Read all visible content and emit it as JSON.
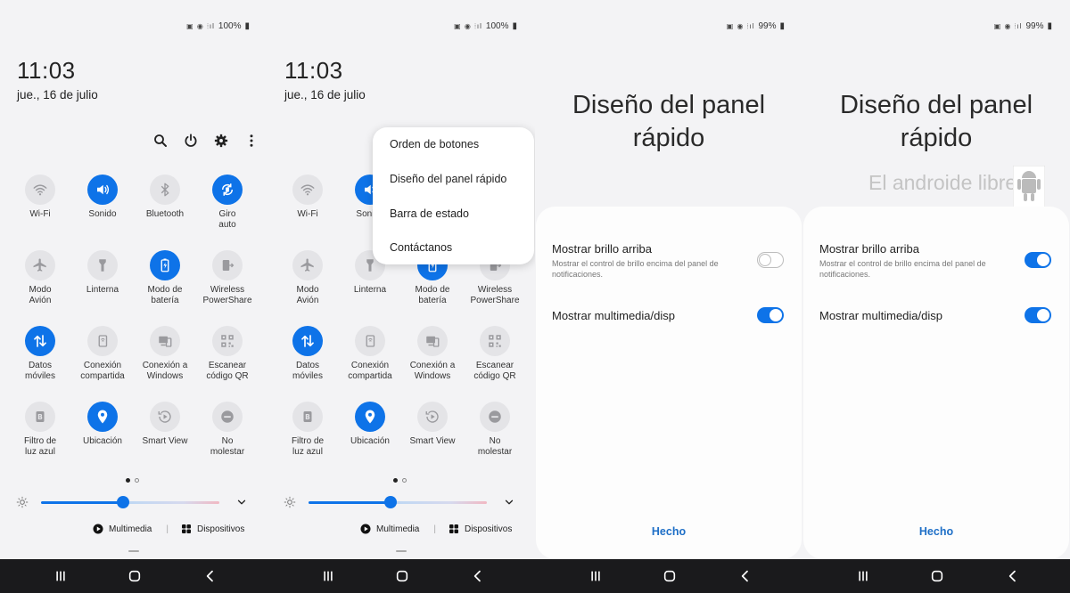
{
  "colors": {
    "accent": "#0e73e8",
    "tile_off": "#e4e4e7",
    "panel_bg": "#f3f3f5",
    "navbar": "#1a1a1c",
    "done_text": "#1e6fc7"
  },
  "status": {
    "icons": "▣ ◉ ⦙ıl",
    "battery_full": "100%",
    "battery_low": "99%"
  },
  "notification_panel": {
    "time": "11:03",
    "date": "jue., 16 de julio",
    "actions": [
      {
        "name": "search",
        "icon": "search-icon"
      },
      {
        "name": "power",
        "icon": "power-icon"
      },
      {
        "name": "settings",
        "icon": "gear-icon"
      },
      {
        "name": "more",
        "icon": "more-vert-icon"
      }
    ],
    "tiles": [
      {
        "label": "Wi-Fi",
        "icon": "wifi-icon",
        "on": false
      },
      {
        "label": "Sonido",
        "icon": "sound-icon",
        "on": true
      },
      {
        "label": "Bluetooth",
        "icon": "bluetooth-icon",
        "on": false
      },
      {
        "label": "Giro\nauto",
        "icon": "rotate-icon",
        "on": true
      },
      {
        "label": "Modo\nAvión",
        "icon": "airplane-icon",
        "on": false
      },
      {
        "label": "Linterna",
        "icon": "flashlight-icon",
        "on": false
      },
      {
        "label": "Modo de\nbatería",
        "icon": "battery-mode-icon",
        "on": true
      },
      {
        "label": "Wireless\nPowerShare",
        "icon": "powershare-icon",
        "on": false
      },
      {
        "label": "Datos\nmóviles",
        "icon": "mobile-data-icon",
        "on": true
      },
      {
        "label": "Conexión\ncompartida",
        "icon": "hotspot-icon",
        "on": false
      },
      {
        "label": "Conexión a\nWindows",
        "icon": "link-windows-icon",
        "on": false
      },
      {
        "label": "Escanear\ncódigo QR",
        "icon": "qr-icon",
        "on": false
      },
      {
        "label": "Filtro de\nluz azul",
        "icon": "blue-light-icon",
        "on": false
      },
      {
        "label": "Ubicación",
        "icon": "location-icon",
        "on": true
      },
      {
        "label": "Smart View",
        "icon": "smart-view-icon",
        "on": false
      },
      {
        "label": "No\nmolestar",
        "icon": "dnd-icon",
        "on": false
      }
    ],
    "page_indicator": {
      "current": 1,
      "total": 2
    },
    "brightness_level": 0.46,
    "media_label": "Multimedia",
    "devices_label": "Dispositivos"
  },
  "menu": {
    "items": [
      "Orden de botones",
      "Diseño del panel rápido",
      "Barra de estado",
      "Contáctanos"
    ]
  },
  "layout_screen": {
    "title_line1": "Diseño del panel",
    "title_line2": "rápido",
    "watermark": "El androide libre",
    "option1_title": "Mostrar brillo arriba",
    "option1_desc": "Mostrar el control de brillo encima del panel de notificaciones.",
    "option2_title": "Mostrar multimedia/disp",
    "done_label": "Hecho",
    "before": {
      "option1_on": false,
      "option2_on": true
    },
    "after": {
      "option1_on": true,
      "option2_on": true
    }
  }
}
